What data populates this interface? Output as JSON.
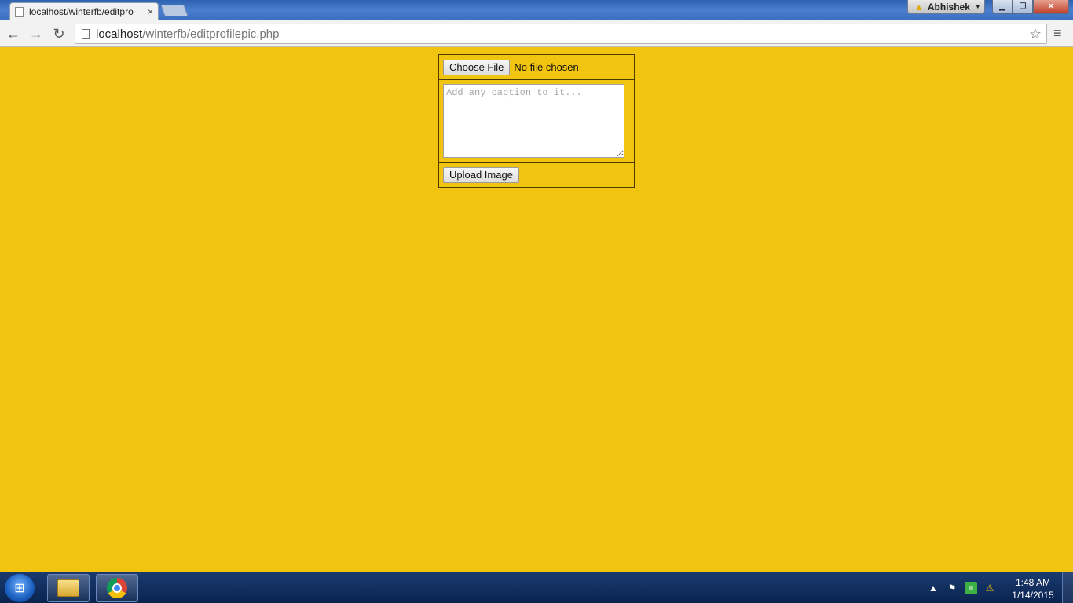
{
  "browser": {
    "tab_title": "localhost/winterfb/editpro",
    "tab_close": "×",
    "profile_name": "Abhishek",
    "url_host": "localhost",
    "url_path": "/winterfb/editprofilepic.php",
    "win_min": "▁",
    "win_max": "❐",
    "win_close": "✕"
  },
  "form": {
    "choose_file_label": "Choose File",
    "file_status": "No file chosen",
    "caption_placeholder": "Add any caption to it...",
    "upload_label": "Upload Image"
  },
  "taskbar": {
    "time": "1:48 AM",
    "date": "1/14/2015"
  },
  "colors": {
    "page_background": "#f1c40f"
  }
}
